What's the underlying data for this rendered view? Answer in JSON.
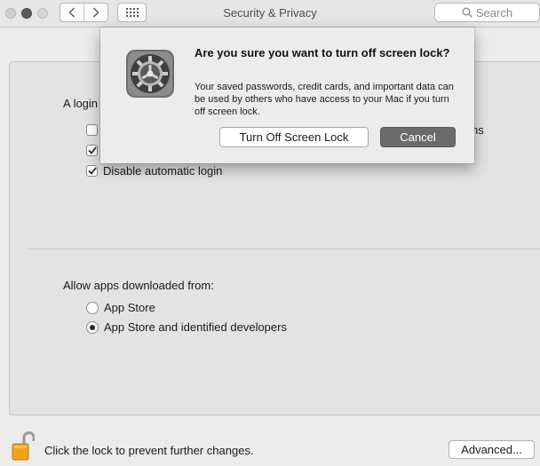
{
  "window": {
    "title": "Security & Privacy",
    "search_placeholder": "Search"
  },
  "general": {
    "login_label_visible": "A login",
    "hidden_option_tail": "ns",
    "disable_auto_login_label": "Disable automatic login",
    "checkboxes": [
      {
        "checked": false
      },
      {
        "checked": true
      },
      {
        "checked": true
      }
    ]
  },
  "gatekeeper": {
    "label": "Allow apps downloaded from:",
    "options": [
      {
        "label": "App Store",
        "selected": false
      },
      {
        "label": "App Store and identified developers",
        "selected": true
      }
    ]
  },
  "footer": {
    "lock_message": "Click the lock to prevent further changes.",
    "advanced_label": "Advanced..."
  },
  "dialog": {
    "title": "Are you sure you want to turn off screen lock?",
    "body": "Your saved passwords, credit cards, and important data can be used by others who have access to your Mac if you turn off screen lock.",
    "confirm_label": "Turn Off Screen Lock",
    "cancel_label": "Cancel"
  }
}
